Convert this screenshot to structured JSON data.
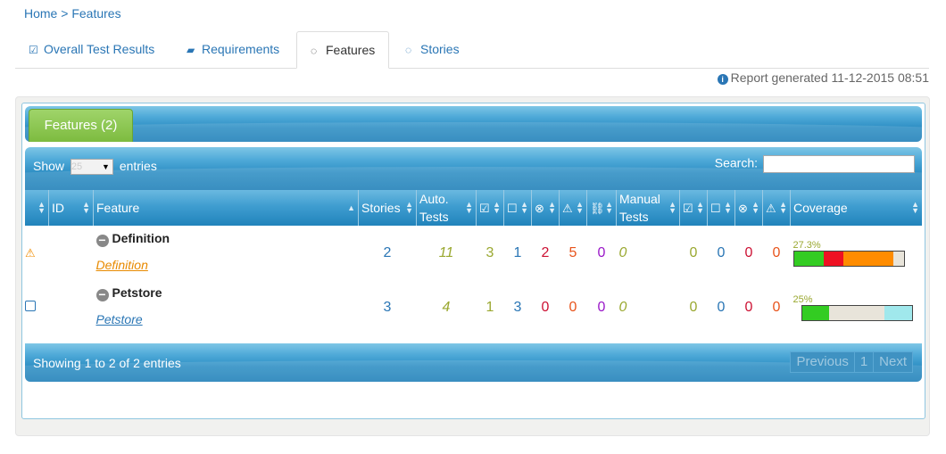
{
  "breadcrumb": {
    "home": "Home",
    "separator": ">",
    "current": "Features"
  },
  "tabs": [
    {
      "label": "Overall Test Results",
      "icon": "check-square-icon"
    },
    {
      "label": "Requirements",
      "icon": "book-icon"
    },
    {
      "label": "Features",
      "icon": "comments-icon",
      "active": true
    },
    {
      "label": "Stories",
      "icon": "comments-icon"
    }
  ],
  "report": {
    "text": "Report generated 11-12-2015 08:51"
  },
  "panel": {
    "title": "Features (2)"
  },
  "controls": {
    "show_label": "Show",
    "entries_label": "entries",
    "page_size": "25",
    "search_label": "Search:",
    "search_value": ""
  },
  "columns": {
    "id": "ID",
    "feature": "Feature",
    "stories": "Stories",
    "auto_tests": "Auto. Tests",
    "manual_tests": "Manual Tests",
    "coverage": "Coverage"
  },
  "rows": [
    {
      "status": "warning",
      "name": "Definition",
      "link": "Definition",
      "stories": "2",
      "auto": "11",
      "pass": "3",
      "pending": "1",
      "fail": "2",
      "error": "5",
      "compromised": "0",
      "manual": "0",
      "m_pass": "0",
      "m_pending": "0",
      "m_fail": "0",
      "m_error": "0",
      "coverage": "27.3%",
      "bar": [
        {
          "color": "#33cc22",
          "pct": 27.3
        },
        {
          "color": "#ee1122",
          "pct": 18.2
        },
        {
          "color": "#ff8c00",
          "pct": 45.5
        },
        {
          "color": "#e8e4da",
          "pct": 9.0
        }
      ]
    },
    {
      "status": "pending",
      "name": "Petstore",
      "link": "Petstore",
      "stories": "3",
      "auto": "4",
      "pass": "1",
      "pending": "3",
      "fail": "0",
      "error": "0",
      "compromised": "0",
      "manual": "0",
      "m_pass": "0",
      "m_pending": "0",
      "m_fail": "0",
      "m_error": "0",
      "coverage": "25%",
      "bar": [
        {
          "color": "#33cc22",
          "pct": 25
        },
        {
          "color": "#e8e4da",
          "pct": 50
        },
        {
          "color": "#a0e8ec",
          "pct": 25
        }
      ]
    }
  ],
  "footer": {
    "showing": "Showing 1 to 2 of 2 entries",
    "previous": "Previous",
    "page": "1",
    "next": "Next"
  }
}
